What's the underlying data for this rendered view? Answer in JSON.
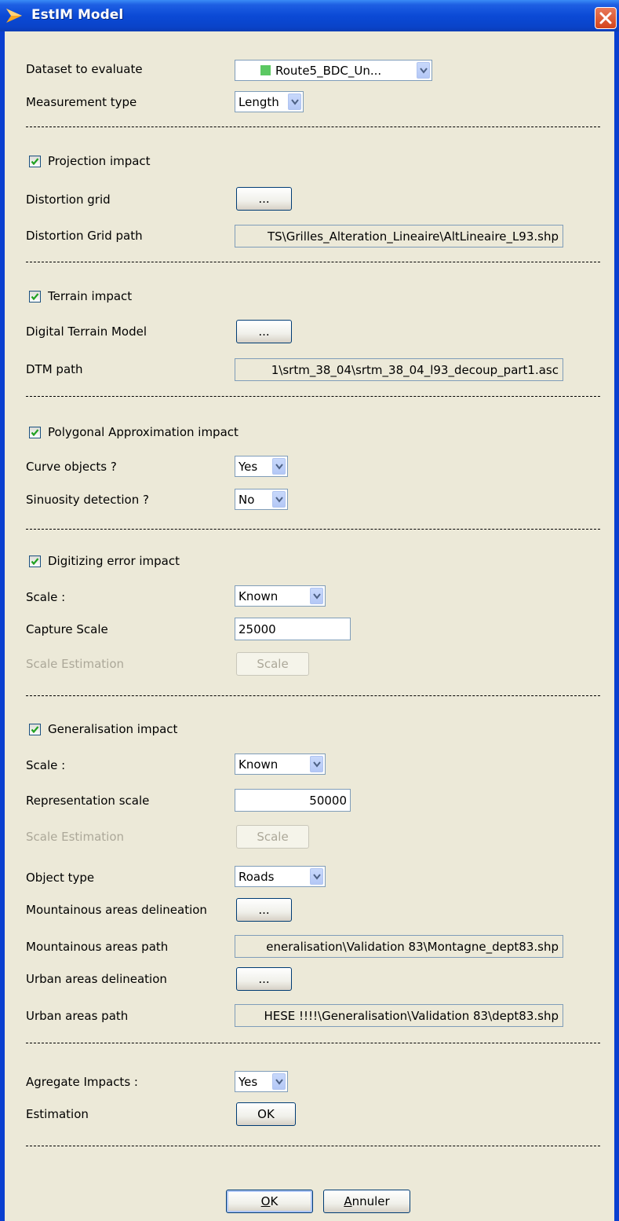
{
  "window": {
    "title": "EstIM Model"
  },
  "dataset": {
    "label": "Dataset to evaluate",
    "value": "Route5_BDC_Un...",
    "color": "#5cc862"
  },
  "measurement": {
    "label": "Measurement type",
    "value": "Length"
  },
  "projection": {
    "header": "Projection impact",
    "grid_label": "Distortion grid",
    "browse": "...",
    "path_label": "Distortion Grid path",
    "path": "TS\\Grilles_Alteration_Lineaire\\AltLineaire_L93.shp"
  },
  "terrain": {
    "header": "Terrain impact",
    "dtm_label": "Digital Terrain Model",
    "browse": "...",
    "path_label": "DTM path",
    "path": "1\\srtm_38_04\\srtm_38_04_l93_decoup_part1.asc"
  },
  "polygonal": {
    "header": "Polygonal Approximation impact",
    "curve_label": "Curve objects ?",
    "curve_value": "Yes",
    "sinuosity_label": "Sinuosity detection ?",
    "sinuosity_value": "No"
  },
  "digitizing": {
    "header": "Digitizing error impact",
    "scale_label": "Scale :",
    "scale_value": "Known",
    "capture_label": "Capture Scale",
    "capture_value": "25000",
    "estimation_label": "Scale Estimation",
    "estimation_button": "Scale"
  },
  "generalisation": {
    "header": "Generalisation impact",
    "scale_label": "Scale :",
    "scale_value": "Known",
    "repr_label": "Representation scale",
    "repr_value": "50000",
    "estimation_label": "Scale Estimation",
    "estimation_button": "Scale",
    "object_label": "Object type",
    "object_value": "Roads",
    "mountain_label": "Mountainous areas delineation",
    "mountain_browse": "...",
    "mountain_path_label": "Mountainous areas path",
    "mountain_path": "eneralisation\\Validation 83\\Montagne_dept83.shp",
    "urban_label": "Urban areas delineation",
    "urban_browse": "...",
    "urban_path_label": "Urban areas path",
    "urban_path": "HESE !!!!\\Generalisation\\Validation 83\\dept83.shp"
  },
  "aggregate": {
    "label": "Agregate Impacts :",
    "value": "Yes"
  },
  "estimation": {
    "label": "Estimation",
    "button": "OK"
  },
  "footer": {
    "ok_mnemonic": "O",
    "ok_rest": "K",
    "cancel_mnemonic": "A",
    "cancel_rest": "nnuler"
  }
}
